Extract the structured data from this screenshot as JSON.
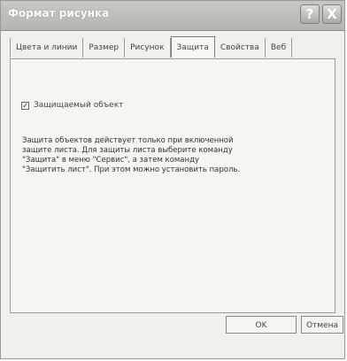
{
  "window": {
    "title": "Формат рисунка",
    "help_label": "?",
    "close_label": "X"
  },
  "tabs": [
    {
      "label": "Цвета и линии",
      "active": false
    },
    {
      "label": "Размер",
      "active": false
    },
    {
      "label": "Рисунок",
      "active": false
    },
    {
      "label": "Защита",
      "active": true
    },
    {
      "label": "Свойства",
      "active": false
    },
    {
      "label": "Веб",
      "active": false
    }
  ],
  "protection": {
    "checkbox_label": "Защищаемый объект",
    "checkbox_checked": true,
    "check_mark": "✓",
    "info_line1": "Защита объектов действует только при включенной",
    "info_line2": "защите листа. Для защиты листа выберите команду",
    "info_line3": "\"Защита\" в меню \"Сервис\", а затем команду",
    "info_line4": "\"Защитить лист\". При этом можно установить пароль."
  },
  "buttons": {
    "ok_label": "OK",
    "cancel_label": "Отмена"
  }
}
